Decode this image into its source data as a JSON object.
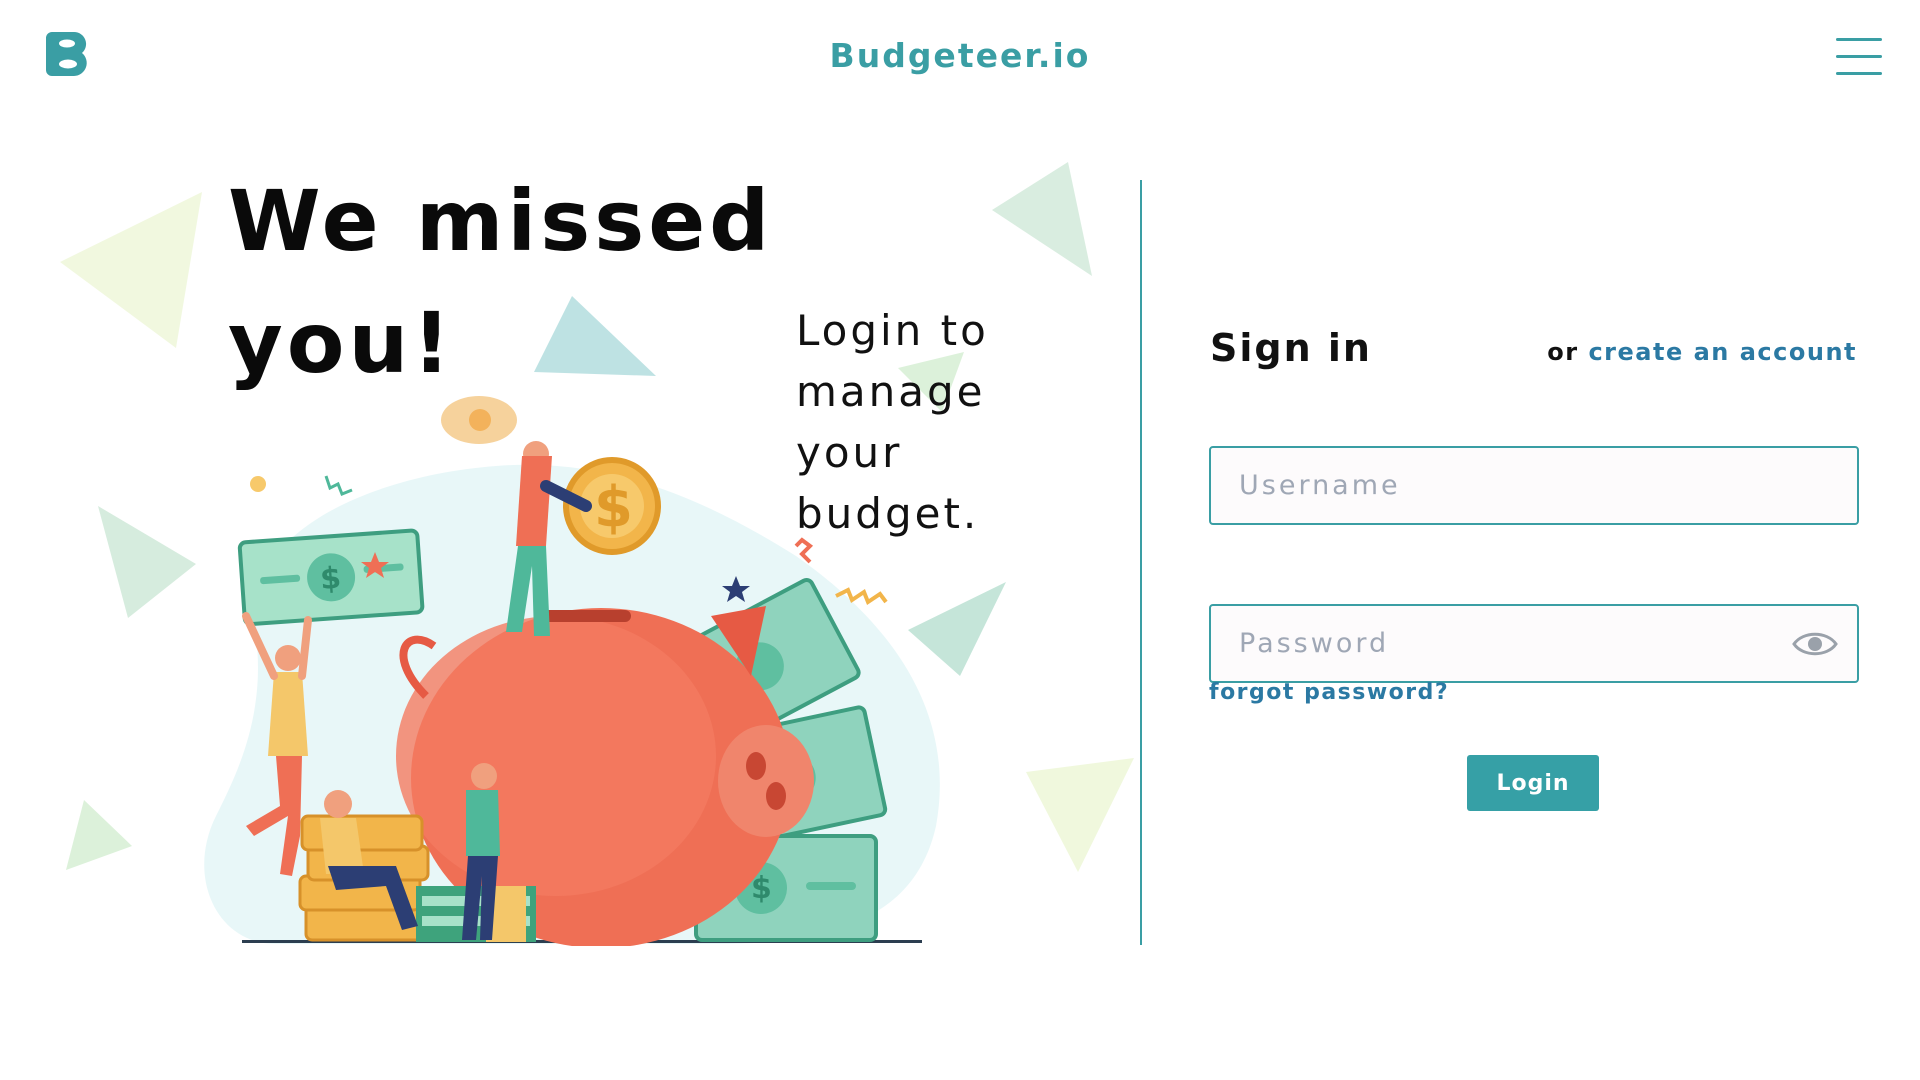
{
  "header": {
    "brand": "Budgeteer.io",
    "logo_icon": "budgeteer-b-logo-icon",
    "menu_icon": "hamburger-menu-icon"
  },
  "hero": {
    "title": "We missed you!",
    "subtitle": "Login to manage your budget.",
    "illustration": "piggy-bank-savings-illustration"
  },
  "signin": {
    "title": "Sign in",
    "or_text": "or",
    "create_account": "create an account",
    "username_placeholder": "Username",
    "password_placeholder": "Password",
    "show_password_icon": "eye-icon",
    "forgot_password": "forgot password?",
    "login_button": "Login"
  },
  "colors": {
    "accent": "#3a9ea4",
    "link": "#2b79a3",
    "button": "#36a0a6"
  }
}
